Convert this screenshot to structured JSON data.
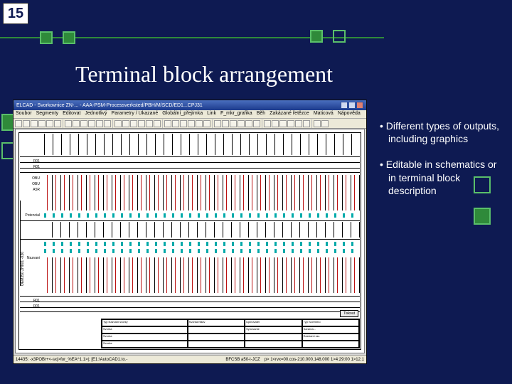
{
  "slide": {
    "number": "15",
    "title": "Terminal block arrangement"
  },
  "bullets": [
    "Different types of outputs, including graphics",
    "Editable in schematics or in terminal block description"
  ],
  "app": {
    "titlebar": "ELCAD - Svorkovnice ZN-... - AAA-PSM-Processverksted/PBH/M/SCD/ED1...CPJ31",
    "menubar": [
      "Soubor",
      "Segmenty",
      "Editovat",
      "Jednotlivý",
      "Parametry / Ukazané",
      "Globální_přejímka",
      "Link",
      "F_mkr_grafika",
      "Běh",
      "Zakázané řetězce",
      "Maticová",
      "Nápověda"
    ],
    "toolbar_count": 38,
    "status": {
      "left": "14435: -x3POBr+<-sx|>for_%EA^1.1>|; [E1:\\AutoCAD1.to.-",
      "mid": "BFCSB   a50-I-JCZ",
      "right": "p> 1<rvx=00.cos-210.000.148.000   1>4:29:00   1>12.1"
    }
  },
  "drawing": {
    "header_cols": [
      "",
      "",
      "",
      "",
      "",
      "",
      "",
      "",
      "",
      "",
      "",
      "",
      "",
      "",
      "",
      "",
      "",
      "",
      "",
      "",
      "",
      "",
      "",
      "",
      "",
      "",
      "",
      "",
      "",
      "",
      "",
      "",
      "",
      "",
      "",
      "",
      ""
    ],
    "left_labels_top": [
      "R01",
      "R01"
    ],
    "left_labels_mid": [
      "OBU",
      "OBU",
      "A5R",
      "",
      "",
      "Potencial",
      "",
      "",
      "",
      "",
      "",
      "",
      "",
      "Nazvani"
    ],
    "left_labels_bot": [
      "R01",
      "R01"
    ],
    "side_label": "OEM350 ZH801 -X30",
    "title_block": {
      "c1": [
        "Typ Nazvani svorky",
        "Svorka",
        "Svorka",
        "Svorka"
      ],
      "c2": [
        "Svorka  hBav",
        "",
        "",
        ""
      ],
      "c3": [
        "Upinovatel",
        "Synovanie",
        "",
        ""
      ],
      "c4": [
        "Typ tvoreniho",
        "Sararna...",
        "Rastrami rac.",
        ""
      ]
    },
    "footer_tag": "Tiskout"
  }
}
